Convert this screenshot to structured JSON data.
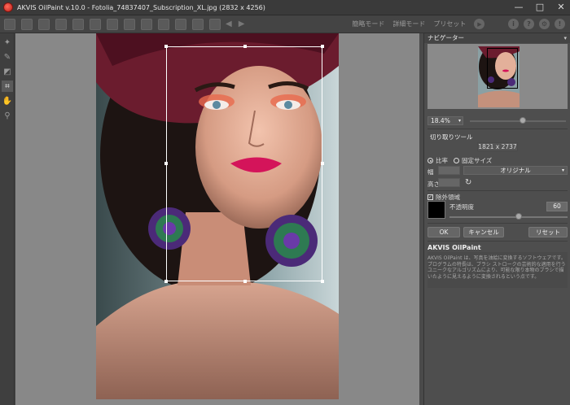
{
  "window": {
    "title": "AKVIS OilPaint v.10.0 - Fotolia_74837407_Subscription_XL.jpg (2832 x 4256)",
    "minimize": "—",
    "maximize": "□",
    "close": "✕"
  },
  "toolbar": {
    "mode_express": "簡略モード",
    "mode_advanced": "詳細モード",
    "preset": "プリセット",
    "run_icon": "▶",
    "info_icon": "i",
    "help_icon": "?",
    "settings_icon": "⚙",
    "notify_icon": "!"
  },
  "navigator": {
    "title": "ナビゲーター",
    "zoom": "18.4%",
    "zoom_slider_fraction": 0.55
  },
  "crop": {
    "title": "切り取りツール",
    "size": "1821 x 2737",
    "ratio_label": "比率",
    "fixed_size_label": "固定サイズ",
    "ratio_mode": "ratio",
    "width_label": "幅",
    "height_label": "高さ",
    "aspect_option": "オリジナル",
    "dropdown_arrow": "▾",
    "rotate_icon": "↻",
    "exclude_label": "除外領域",
    "exclude_checked": true,
    "opacity_label": "不透明度",
    "opacity_value": "60",
    "exclude_color": "#000000",
    "ok_label": "OK",
    "cancel_label": "キャンセル",
    "reset_label": "リセット"
  },
  "about": {
    "title": "AKVIS OilPaint",
    "text": "AKVIS OilPaint は、写真を油絵に変換するソフトウェアです。プログラムの特長は、ブラシ ストロークの芸術的な適用を行うユニークなアルゴリズムにより、可能な限り本物のブラシで描いたように見えるように変換されるという点です。"
  }
}
